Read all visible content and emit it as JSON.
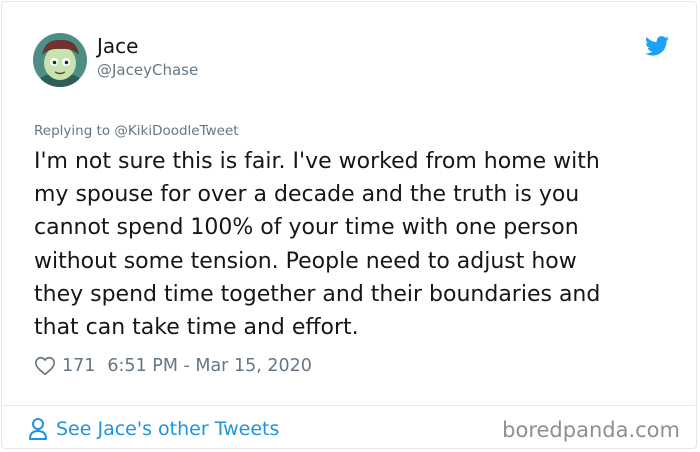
{
  "author": {
    "display_name": "Jace",
    "handle": "@JaceyChase",
    "avatar_icon": "cartoon-avatar"
  },
  "header": {
    "brand_icon": "twitter-bird-icon",
    "brand_color": "#1da1f2"
  },
  "reply": {
    "label": "Replying to @KikiDoodleTweet"
  },
  "tweet": {
    "lines": [
      "I'm not sure this is fair. I've worked from home with",
      "my spouse for over a decade and the truth is you",
      "cannot spend 100% of your time with one person",
      "without some tension. People need to adjust how",
      "they spend time together and their boundaries and",
      "that can take time and effort."
    ]
  },
  "meta": {
    "like_icon": "heart-icon",
    "likes": "171",
    "timestamp": "6:51 PM - Mar 15, 2020"
  },
  "footer": {
    "see_more_icon": "person-icon",
    "see_more_label": "See Jace's other Tweets",
    "link_color": "#1b95e0",
    "watermark": "boredpanda.com"
  }
}
